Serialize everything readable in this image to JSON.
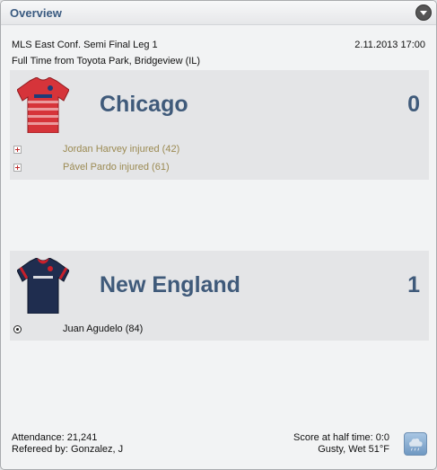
{
  "panel": {
    "title": "Overview",
    "collapse_icon": "chevron-down-icon"
  },
  "match": {
    "competition": "MLS East Conf. Semi Final Leg 1",
    "datetime": "2.11.2013 17:00",
    "status": "Full Time from Toyota Park, Bridgeview (IL)"
  },
  "home": {
    "name": "Chicago",
    "score": "0",
    "jersey_icon": "chicago-jersey-icon",
    "jersey_color": "#d6343a",
    "events": [
      {
        "icon": "injury-icon",
        "text": "Jordan Harvey injured (42)"
      },
      {
        "icon": "injury-icon",
        "text": "Pável Pardo injured (61)"
      }
    ]
  },
  "away": {
    "name": "New England",
    "score": "1",
    "jersey_icon": "new-england-jersey-icon",
    "jersey_color": "#1f2d4f",
    "events": [
      {
        "icon": "ball-icon",
        "text": "Juan Agudelo (84)"
      }
    ]
  },
  "footer": {
    "attendance": "Attendance: 21,241",
    "referee": "Refereed by: Gonzalez, J",
    "halftime": "Score at half time: 0:0",
    "weather": "Gusty, Wet 51°F",
    "weather_icon": "rain-cloud-icon"
  }
}
